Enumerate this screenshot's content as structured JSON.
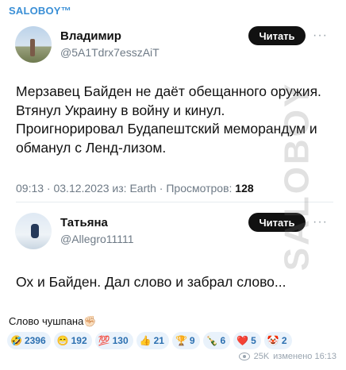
{
  "channel_name": "SALOBOY™",
  "watermark": "SALOBOY",
  "tweet1": {
    "name": "Владимир",
    "handle": "@5A1Tdrx7esszAiT",
    "follow_label": "Читать",
    "more_label": "···",
    "text": "Мерзавец Байден не даёт обещанного оружия. Втянул Украину в войну и кинул. Проигнорировал Будапештский меморандум и обманул с Ленд-лизом.",
    "meta_prefix": "09:13 · 03.12.2023 из: Earth · Просмотров: ",
    "views": "128"
  },
  "tweet2": {
    "name": "Татьяна",
    "handle": "@Allegro11111",
    "follow_label": "Читать",
    "more_label": "···",
    "text": "Ох и Байден. Дал слово и забрал слово..."
  },
  "caption": "Слово чушпана✊🏻",
  "reactions": [
    {
      "emoji": "🤣",
      "count": "2396"
    },
    {
      "emoji": "😁",
      "count": "192"
    },
    {
      "emoji": "💯",
      "count": "130"
    },
    {
      "emoji": "👍",
      "count": "21"
    },
    {
      "emoji": "🏆",
      "count": "9"
    },
    {
      "emoji": "🍾",
      "count": "6"
    },
    {
      "emoji": "❤️",
      "count": "5"
    },
    {
      "emoji": "🤡",
      "count": "2"
    }
  ],
  "footer": {
    "views": "25K",
    "edited": "изменено 16:13"
  }
}
